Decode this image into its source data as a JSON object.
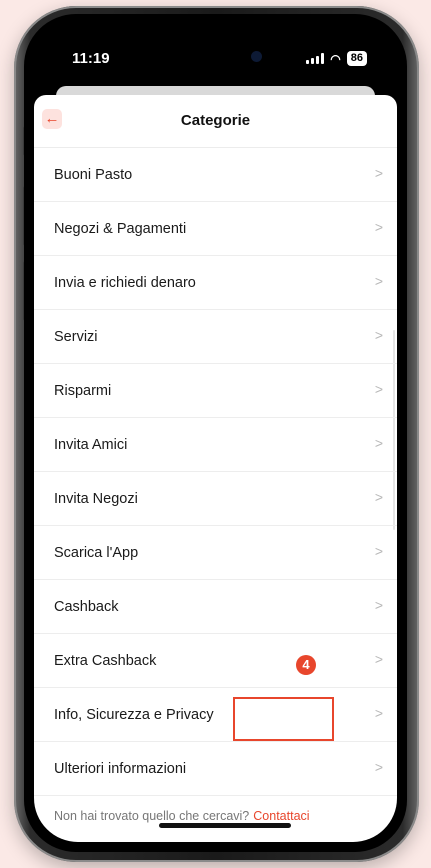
{
  "status_bar": {
    "time": "11:19",
    "battery": "86"
  },
  "header": {
    "title": "Categorie"
  },
  "categories": [
    {
      "label": "Buoni Pasto"
    },
    {
      "label": "Negozi & Pagamenti"
    },
    {
      "label": "Invia e richiedi denaro"
    },
    {
      "label": "Servizi"
    },
    {
      "label": "Risparmi"
    },
    {
      "label": "Invita Amici"
    },
    {
      "label": "Invita Negozi"
    },
    {
      "label": "Scarica l'App"
    },
    {
      "label": "Cashback"
    },
    {
      "label": "Extra Cashback"
    },
    {
      "label": "Info, Sicurezza e Privacy"
    },
    {
      "label": "Ulteriori informazioni"
    }
  ],
  "footer": {
    "prompt": "Non hai trovato quello che cercavi?",
    "contact_link": "Contattaci"
  },
  "annotation": {
    "step_number": "4"
  },
  "colors": {
    "accent": "#e8462c",
    "background": "#fbe9e6"
  }
}
